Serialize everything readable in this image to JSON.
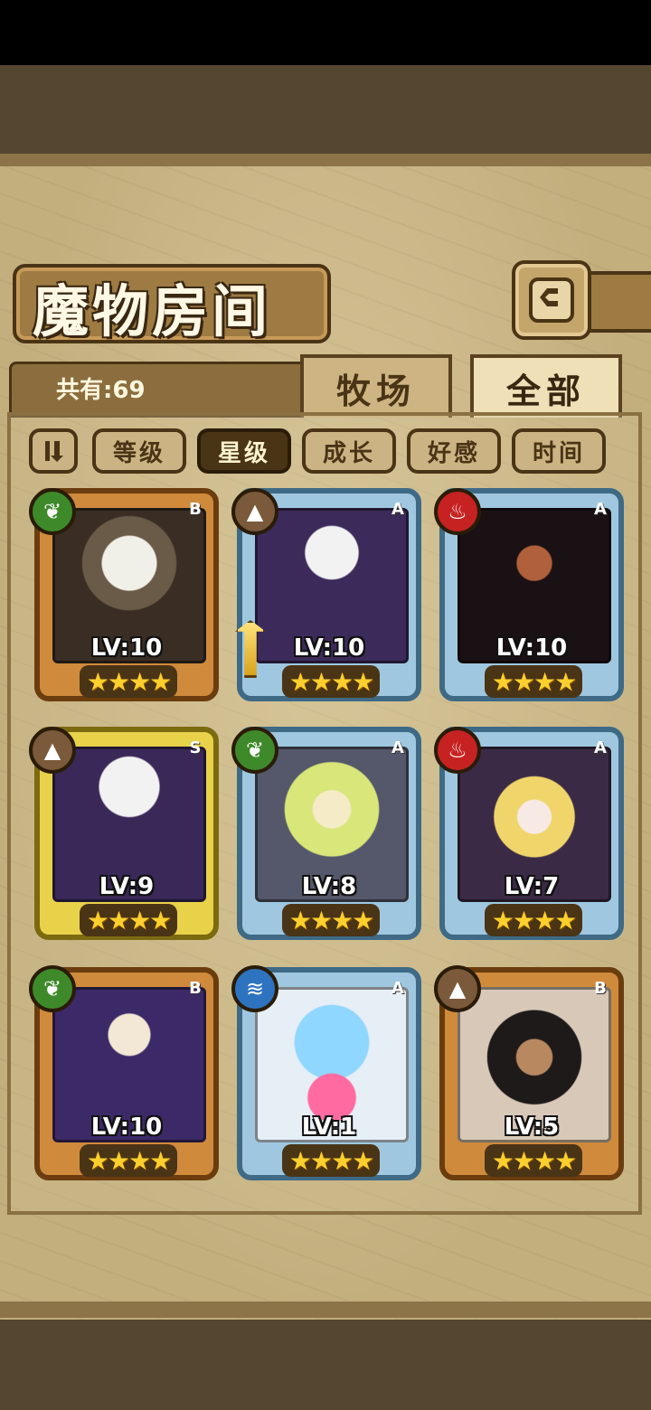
{
  "header": {
    "title": "魔物房间"
  },
  "count_label": "共有:69",
  "tabs": [
    {
      "label": "牧场",
      "active": false
    },
    {
      "label": "全部",
      "active": true
    }
  ],
  "sort_buttons": [
    {
      "label": "等级",
      "active": false
    },
    {
      "label": "星级",
      "active": true
    },
    {
      "label": "成长",
      "active": false
    },
    {
      "label": "好感",
      "active": false
    },
    {
      "label": "时间",
      "active": false
    }
  ],
  "monsters": [
    {
      "level": "LV:10",
      "rank": "B",
      "element": "nature",
      "stars": 4,
      "icon": "owl-knight"
    },
    {
      "level": "LV:10",
      "rank": "A",
      "element": "earth",
      "stars": 4,
      "icon": "skull-girl",
      "equipped": "sword"
    },
    {
      "level": "LV:10",
      "rank": "A",
      "element": "fire",
      "stars": 4,
      "icon": "dark-warrior"
    },
    {
      "level": "LV:9",
      "rank": "S",
      "element": "earth",
      "stars": 4,
      "icon": "skull-girl"
    },
    {
      "level": "LV:8",
      "rank": "A",
      "element": "nature",
      "stars": 4,
      "icon": "cat-girl"
    },
    {
      "level": "LV:7",
      "rank": "A",
      "element": "fire",
      "stars": 4,
      "icon": "blonde-girl"
    },
    {
      "level": "LV:10",
      "rank": "B",
      "element": "nature",
      "stars": 4,
      "icon": "hooded-mage"
    },
    {
      "level": "LV:1",
      "rank": "A",
      "element": "water",
      "stars": 4,
      "icon": "slime-girl"
    },
    {
      "level": "LV:5",
      "rank": "B",
      "element": "earth",
      "stars": 4,
      "icon": "elf-girl"
    }
  ],
  "stars_text": "★★★★",
  "colors": {
    "rank_b": "#d08a3c",
    "rank_a": "#9fc8e0",
    "rank_s": "#e8d24a"
  }
}
